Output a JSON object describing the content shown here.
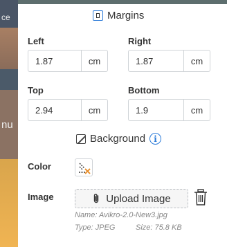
{
  "background_fragments": [
    "ce",
    "nu"
  ],
  "margins": {
    "title": "Margins",
    "left": {
      "label": "Left",
      "value": "1.87",
      "unit": "cm"
    },
    "right": {
      "label": "Right",
      "value": "1.87",
      "unit": "cm"
    },
    "top": {
      "label": "Top",
      "value": "2.94",
      "unit": "cm"
    },
    "bottom": {
      "label": "Bottom",
      "value": "1.9",
      "unit": "cm"
    }
  },
  "background": {
    "title": "Background",
    "color_label": "Color",
    "image_label": "Image",
    "upload_label": "Upload Image",
    "file_name": "Name: Avikro-2.0-New3.jpg",
    "file_type": "Type: JPEG",
    "file_size": "Size: 75.8 KB"
  },
  "colors": {
    "accent": "#2a7ad8",
    "delete_x": "#e8902f"
  }
}
